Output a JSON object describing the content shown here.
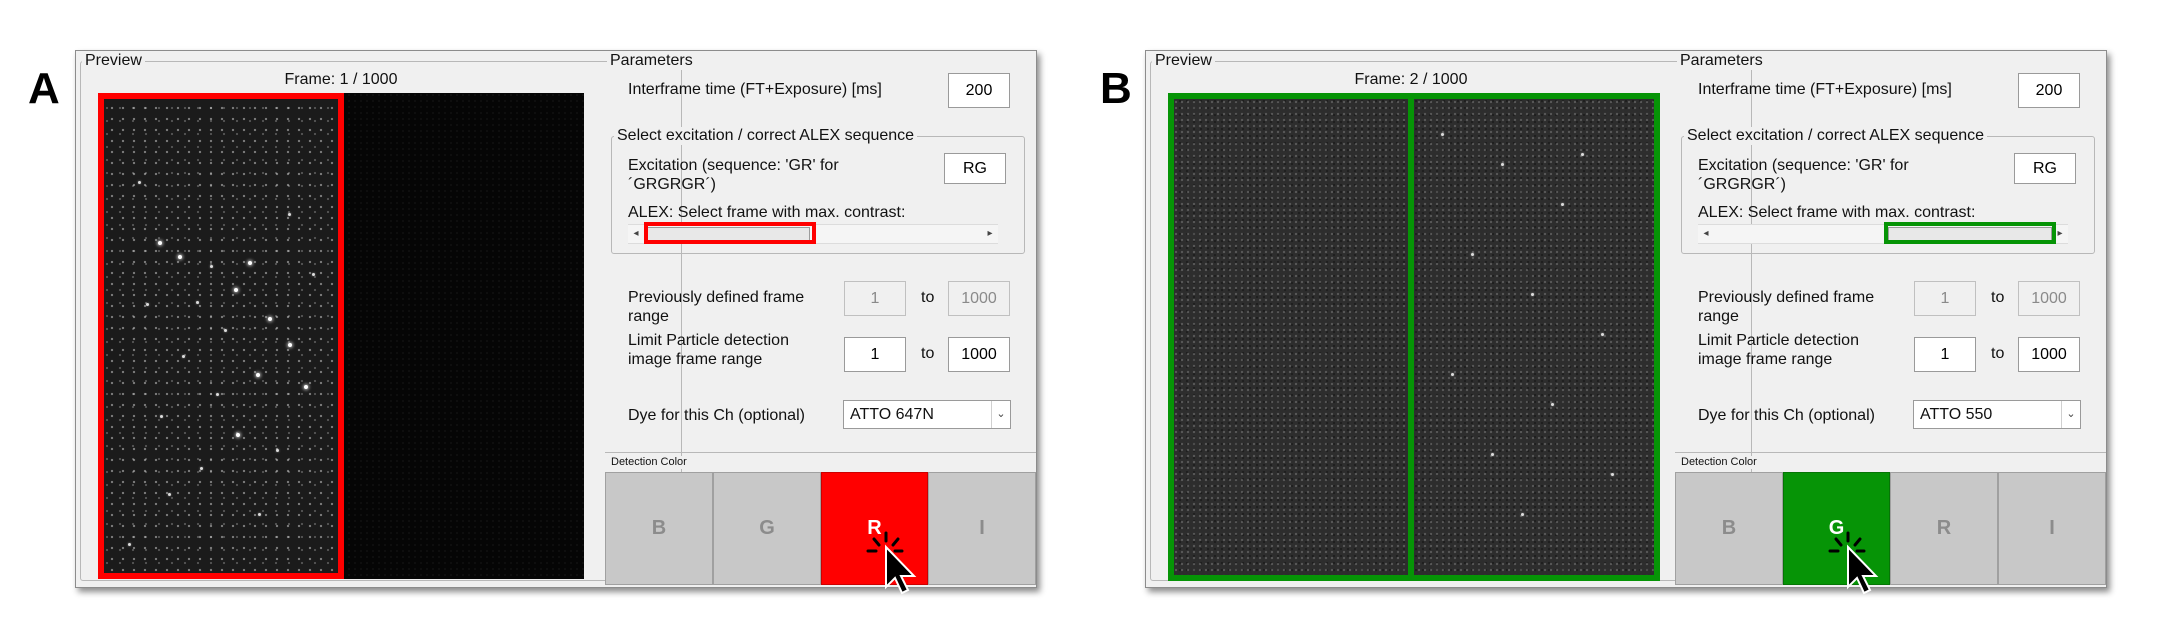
{
  "panels": [
    {
      "letter": "A",
      "preview_title": "Preview",
      "frame_label": "Frame: 1 / 1000",
      "parameters_title": "Parameters",
      "interframe_label": "Interframe time (FT+Exposure) [ms]",
      "interframe_value": "200",
      "excitation_group_title": "Select excitation / correct ALEX sequence",
      "excitation_label": "Excitation (sequence: 'GR' for ´GRGRGR´)",
      "excitation_value": "RG",
      "alex_label": "ALEX: Select frame with max. contrast:",
      "prev_range_label": "Previously defined frame range",
      "prev_range_from": "1",
      "prev_range_to_word": "to",
      "prev_range_to": "1000",
      "limit_label": "Limit Particle detection image frame range",
      "limit_from": "1",
      "limit_to_word": "to",
      "limit_to": "1000",
      "dye_label": "Dye for this Ch (optional)",
      "dye_value": "ATTO 647N",
      "detection_title": "Detection Color",
      "buttons": [
        "B",
        "G",
        "R",
        "I"
      ],
      "active_button": "R",
      "highlight_color": "#ff0000"
    },
    {
      "letter": "B",
      "preview_title": "Preview",
      "frame_label": "Frame: 2 / 1000",
      "parameters_title": "Parameters",
      "interframe_label": "Interframe time (FT+Exposure) [ms]",
      "interframe_value": "200",
      "excitation_group_title": "Select excitation / correct ALEX sequence",
      "excitation_label": "Excitation (sequence: 'GR' for ´GRGRGR´)",
      "excitation_value": "RG",
      "alex_label": "ALEX: Select frame with max. contrast:",
      "prev_range_label": "Previously defined frame range",
      "prev_range_from": "1",
      "prev_range_to_word": "to",
      "prev_range_to": "1000",
      "limit_label": "Limit Particle detection image frame range",
      "limit_from": "1",
      "limit_to_word": "to",
      "limit_to": "1000",
      "dye_label": "Dye for this Ch (optional)",
      "dye_value": "ATTO 550",
      "detection_title": "Detection Color",
      "buttons": [
        "B",
        "G",
        "R",
        "I"
      ],
      "active_button": "G",
      "highlight_color": "#069406"
    }
  ],
  "icons": {
    "scroll_left": "◂",
    "scroll_right": "▸",
    "dropdown_arrow": "⌄"
  }
}
